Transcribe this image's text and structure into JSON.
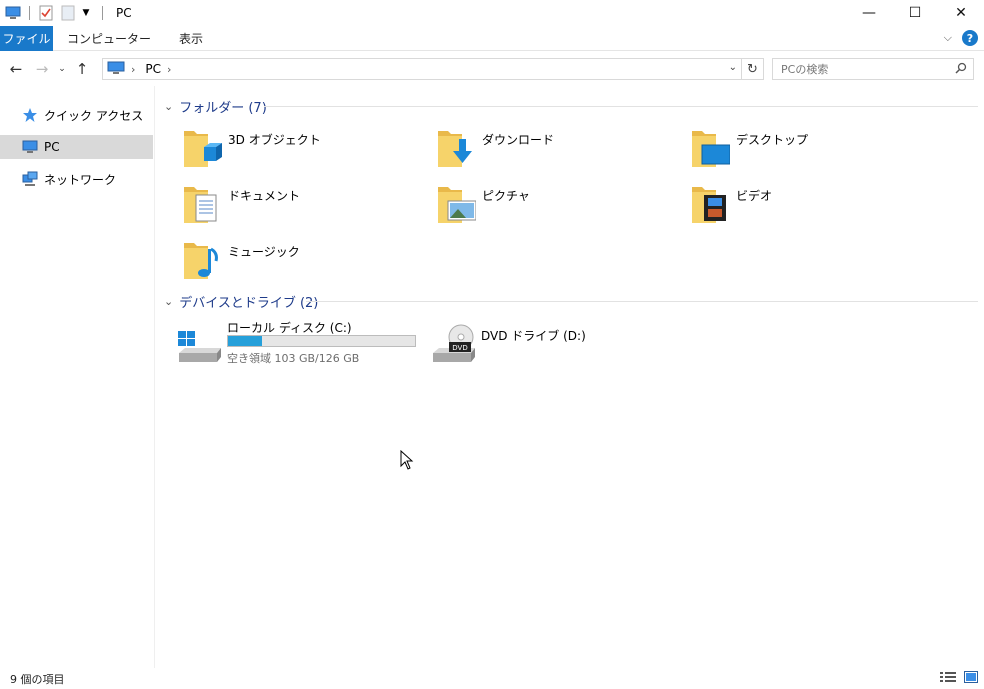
{
  "window": {
    "title": "PC",
    "controls": {
      "minimize": "—",
      "maximize": "☐",
      "close": "✕"
    }
  },
  "ribbon": {
    "tabs": [
      "ファイル",
      "コンピューター",
      "表示"
    ]
  },
  "address": {
    "crumb": "PC",
    "search_placeholder": "PCの検索"
  },
  "nav": {
    "items": [
      {
        "label": "クイック アクセス",
        "icon": "star-icon"
      },
      {
        "label": "PC",
        "icon": "computer-icon",
        "selected": true
      },
      {
        "label": "ネットワーク",
        "icon": "network-icon"
      }
    ]
  },
  "folders": {
    "header": "フォルダー (7)",
    "items": [
      {
        "name": "3D オブジェクト",
        "overlay": "cube"
      },
      {
        "name": "ダウンロード",
        "overlay": "download-arrow"
      },
      {
        "name": "デスクトップ",
        "overlay": "desktop"
      },
      {
        "name": "ドキュメント",
        "overlay": "document"
      },
      {
        "name": "ピクチャ",
        "overlay": "picture"
      },
      {
        "name": "ビデオ",
        "overlay": "film"
      },
      {
        "name": "ミュージック",
        "overlay": "music-note"
      }
    ]
  },
  "drives": {
    "header": "デバイスとドライブ (2)",
    "items": [
      {
        "name": "ローカル ディスク (C:)",
        "free_text": "空き領域 103 GB/126 GB",
        "used_fraction": 0.18,
        "icon": "windows-disk-icon"
      },
      {
        "name": "DVD ドライブ (D:)",
        "icon": "dvd-drive-icon",
        "badge": "DVD"
      }
    ]
  },
  "status": {
    "count": "9 個の項目"
  },
  "colors": {
    "accent": "#1979ca",
    "header_text": "#1e3b8a",
    "folder": "#f3c95a",
    "progress": "#26a0da"
  }
}
